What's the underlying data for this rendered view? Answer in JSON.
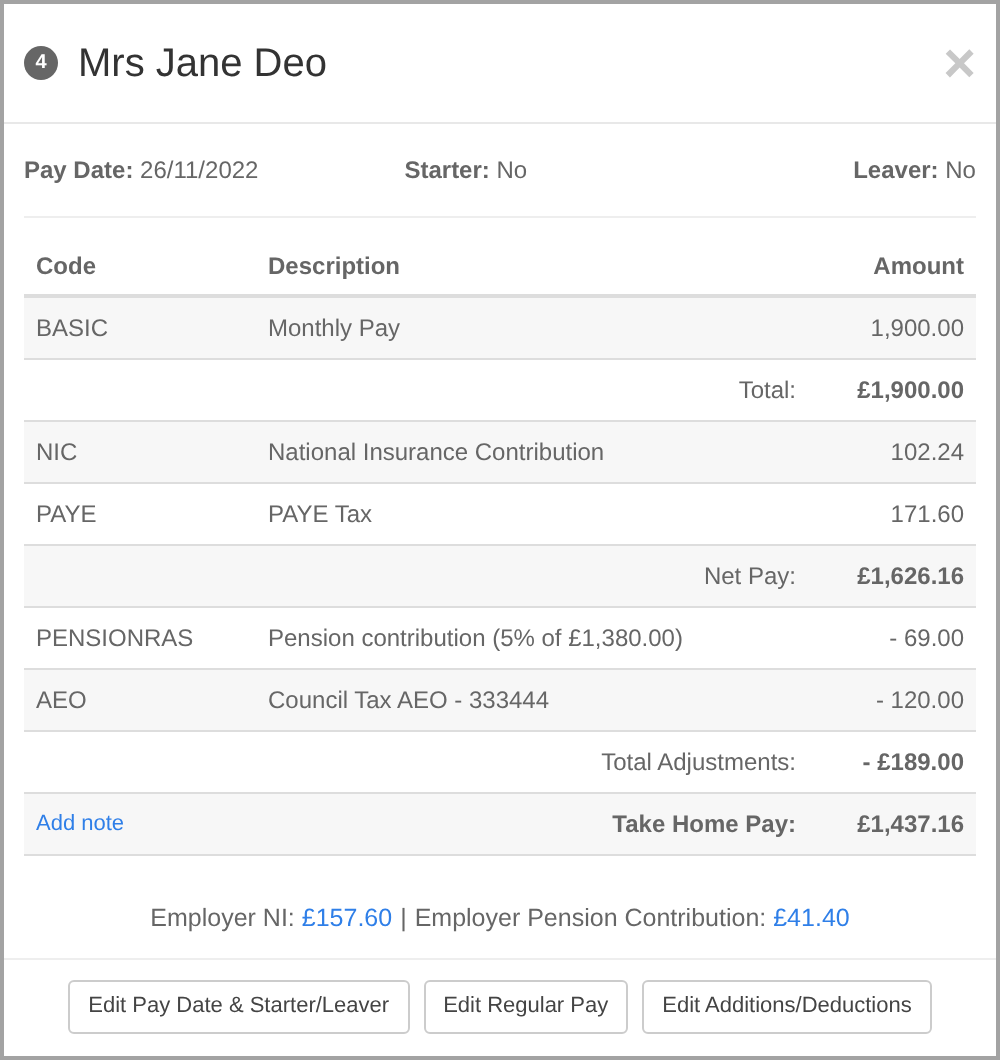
{
  "dialog": {
    "badge": "4",
    "title": "Mrs Jane Deo",
    "close": "×"
  },
  "info": [
    {
      "label": "Pay Date:",
      "value": "26/11/2022"
    },
    {
      "label": "Starter:",
      "value": "No"
    },
    {
      "label": "Leaver:",
      "value": "No"
    }
  ],
  "table": {
    "columns": [
      "Code",
      "Description",
      "Amount"
    ],
    "rows": [
      {
        "kind": "item",
        "code": "BASIC",
        "description": "Monthly Pay",
        "amount": "1,900.00"
      },
      {
        "kind": "summary",
        "label": "Total:",
        "amount": "£1,900.00"
      },
      {
        "kind": "item",
        "code": "NIC",
        "description": "National Insurance Contribution",
        "amount": "102.24"
      },
      {
        "kind": "item",
        "code": "PAYE",
        "description": "PAYE Tax",
        "amount": "171.60"
      },
      {
        "kind": "summary",
        "label": "Net Pay:",
        "amount": "£1,626.16"
      },
      {
        "kind": "item",
        "code": "PENSIONRAS",
        "description": "Pension contribution (5% of £1,380.00)",
        "amount": "- 69.00"
      },
      {
        "kind": "item",
        "code": "AEO",
        "description": "Council Tax AEO - 333444",
        "amount": "- 120.00"
      },
      {
        "kind": "summary",
        "label": "Total Adjustments:",
        "amount": "- £189.00"
      },
      {
        "kind": "final",
        "link": "Add note",
        "label": "Take Home Pay:",
        "amount": "£1,437.16"
      }
    ]
  },
  "employer": {
    "separator": "|",
    "items": [
      {
        "label": "Employer NI:",
        "value": "£157.60"
      },
      {
        "label": "Employer Pension Contribution:",
        "value": "£41.40"
      }
    ]
  },
  "buttons": [
    "Edit Pay Date & Starter/Leaver",
    "Edit Regular Pay",
    "Edit Additions/Deductions"
  ]
}
